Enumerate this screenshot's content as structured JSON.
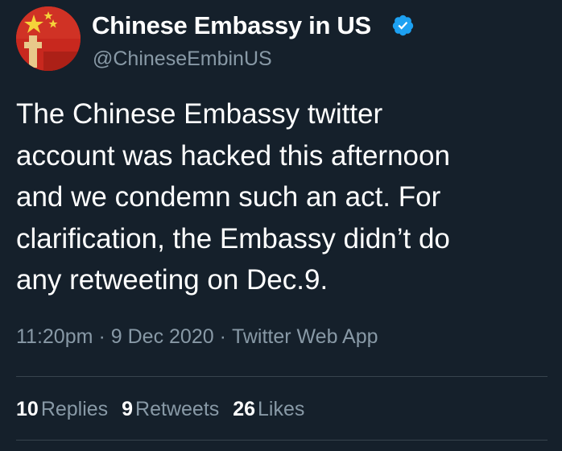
{
  "account": {
    "display_name": "Chinese Embassy in US",
    "handle": "@ChineseEmbinUS",
    "verified_icon": "verified-badge-icon",
    "avatar_icon": "chinese-flag-avatar"
  },
  "tweet": {
    "lines": [
      "The Chinese Embassy twitter",
      "account was hacked this afternoon",
      "and we condemn such an act. For",
      "clarification, the Embassy didn’t do",
      "any retweeting on Dec.9."
    ]
  },
  "meta": {
    "time": "11:20pm",
    "separator": "·",
    "date": "9 Dec 2020",
    "source": "Twitter Web App"
  },
  "stats": {
    "replies_count": "10",
    "replies_label": "Replies",
    "retweets_count": "9",
    "retweets_label": "Retweets",
    "likes_count": "26",
    "likes_label": "Likes"
  },
  "colors": {
    "background": "#15202b",
    "secondary_text": "#8899a6",
    "verified": "#1da1f2",
    "divider": "#38444d"
  }
}
